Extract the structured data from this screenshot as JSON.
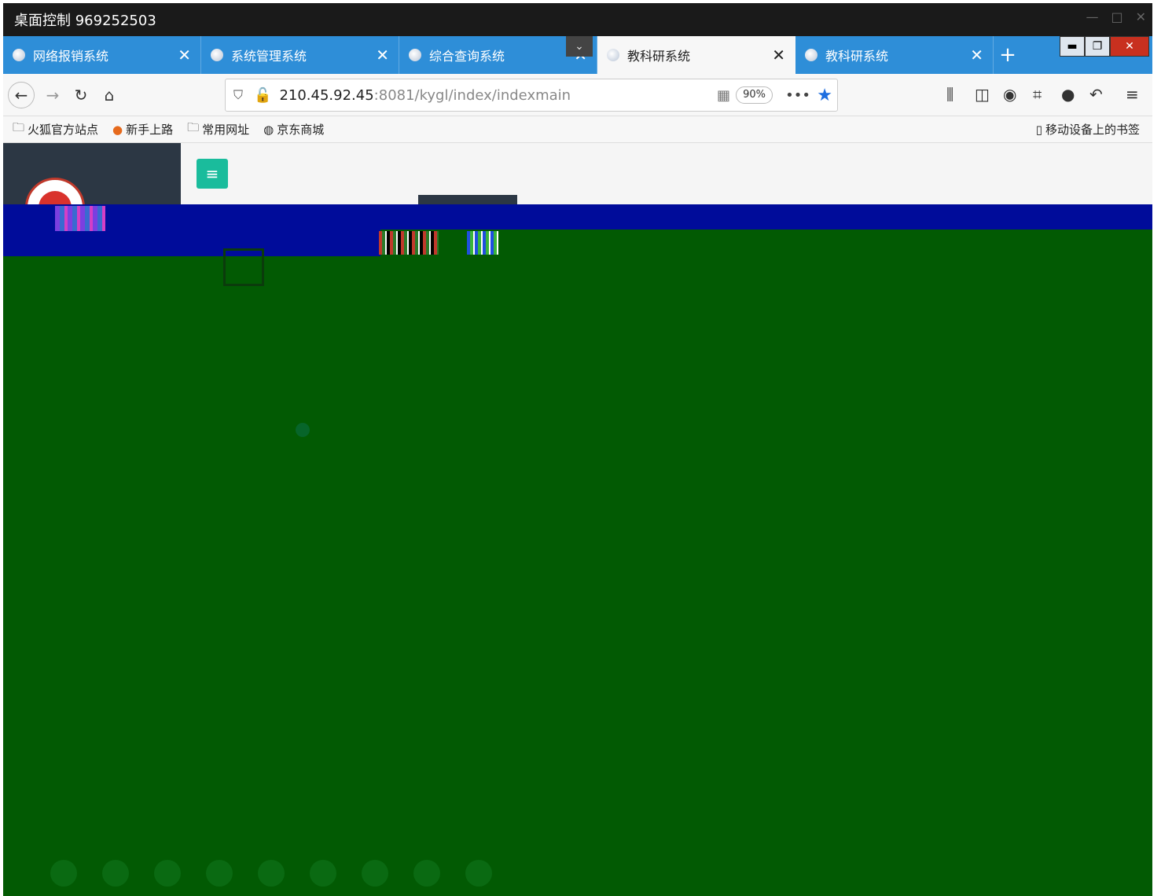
{
  "remote": {
    "title": "桌面控制 969252503"
  },
  "tabs": [
    {
      "label": "网络报销系统"
    },
    {
      "label": "系统管理系统"
    },
    {
      "label": "综合查询系统"
    },
    {
      "label": "教科研系统"
    },
    {
      "label": "教科研系统"
    }
  ],
  "address_bar": {
    "url_host": "210.45.92.45",
    "url_path_dim": ":8081",
    "url_path": "/kygl/index/indexmain",
    "zoom": "90%"
  },
  "bookmarks": [
    {
      "label": "火狐官方站点",
      "icon": "folder-icon"
    },
    {
      "label": "新手上路",
      "icon": "firefox-icon"
    },
    {
      "label": "常用网址",
      "icon": "folder-icon"
    },
    {
      "label": "京东商城",
      "icon": "globe-icon"
    }
  ],
  "bookmarks_right": "移动设备上的书签",
  "colors": {
    "tab_strip": "#2e8ed8",
    "sidebar": "#2c3744",
    "menu_button": "#1abc9c",
    "glitch_blue": "#000c9a",
    "glitch_green": "#025a03"
  }
}
